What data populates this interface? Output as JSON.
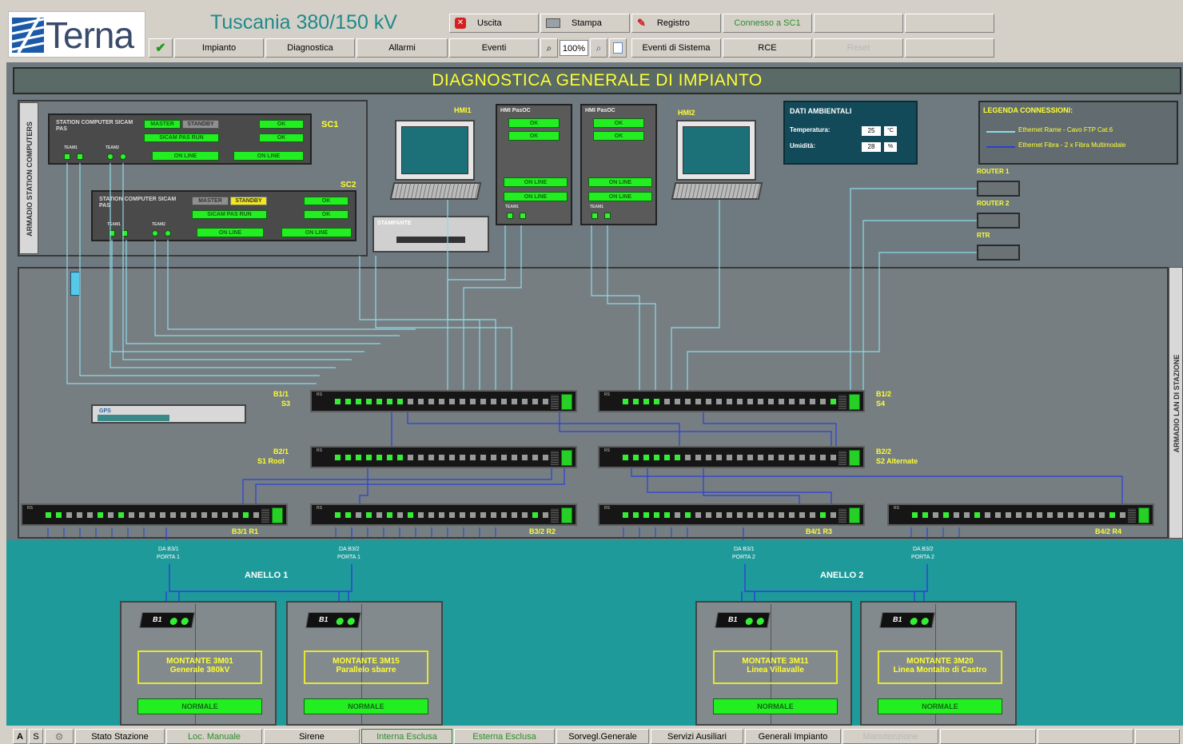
{
  "header": {
    "logo_text": "Terna",
    "station_name": "Tuscania 380/150 kV",
    "buttons": {
      "exit": "Uscita",
      "print": "Stampa",
      "records": "Registro",
      "connection": "Connesso a SC1",
      "plant": "Impianto",
      "diagnostics": "Diagnostica",
      "alarms": "Allarmi",
      "events": "Eventi",
      "zoom_level": "100%",
      "system_events": "Eventi di Sistema",
      "rce": "RCE",
      "disabled_btn": "Reset"
    }
  },
  "main": {
    "title": "DIAGNOSTICA GENERALE DI IMPIANTO",
    "cabinet_label": "ARMADIO STATION COMPUTERS",
    "lan_cabinet_label": "ARMADIO LAN DI STAZIONE",
    "sc1": {
      "id": "SC1",
      "name": "STATION COMPUTER SICAM PAS",
      "master": "MASTER",
      "standby": "STANDBY",
      "status": "SICAM PAS RUN",
      "ok1": "OK",
      "ok2": "OK",
      "online1": "ON LINE",
      "online2": "ON LINE",
      "team1": "TEAM1",
      "team2": "TEAM2"
    },
    "sc2": {
      "id": "SC2",
      "name": "STATION COMPUTER SICAM PAS",
      "master": "MASTER",
      "standby": "STANDBY",
      "status": "SICAM PAS RUN",
      "ok1": "OK",
      "ok2": "OK",
      "online1": "ON LINE",
      "online2": "ON LINE",
      "team1": "TEAM1",
      "team2": "TEAM2"
    },
    "hmi1": "HMI1",
    "hmi2": "HMI2",
    "hmi_pasoc1": {
      "title": "HMI PasOC",
      "ok1": "OK",
      "ok2": "OK",
      "online1": "ON LINE",
      "online2": "ON LINE",
      "team": "TEAM1"
    },
    "hmi_pasoc2": {
      "title": "HMI PasOC",
      "ok1": "OK",
      "ok2": "OK",
      "online1": "ON LINE",
      "online2": "ON LINE",
      "team": "TEAM1"
    },
    "printer": "STAMPANTE",
    "gps": "GPS",
    "env": {
      "title": "DATI AMBIENTALI",
      "temp_label": "Temperatura:",
      "temp_value": "25",
      "temp_unit": "°C",
      "hum_label": "Umidità:",
      "hum_value": "28",
      "hum_unit": "%"
    },
    "legend": {
      "title": "LEGENDA CONNESSIONI:",
      "copper": "Ethernet Rame - Cavo FTP Cat.6",
      "fiber": "Ethernet Fibra - 2 x Fibra Multimodale"
    },
    "routers": {
      "r1": "ROUTER 1",
      "r2": "ROUTER 2",
      "rtr": "RTR"
    },
    "switches": {
      "b11": "B1/1",
      "b11_sub": "S3",
      "b12": "B1/2",
      "b12_sub": "S4",
      "b21": "B2/1",
      "b21_sub": "S1 Root",
      "b22": "B2/2",
      "b22_sub": "S2 Alternate",
      "b31": "B3/1  R1",
      "b32": "B3/2  R2",
      "b41": "B4/1  R3",
      "b42": "B4/2  R4"
    },
    "ring1": "ANELLO 1",
    "ring2": "ANELLO 2",
    "ports": {
      "p1": "DA B3/1",
      "p1b": "PORTA 1",
      "p2": "DA B3/2",
      "p2b": "PORTA 1",
      "p3": "DA B3/1",
      "p3b": "PORTA 2",
      "p4": "DA B3/2",
      "p4b": "PORTA 2"
    },
    "bays": [
      {
        "b1": "B1",
        "title": "MONTANTE 3M01",
        "subtitle": "Generale 380kV",
        "status": "NORMALE"
      },
      {
        "b1": "B1",
        "title": "MONTANTE 3M15",
        "subtitle": "Parallelo sbarre",
        "status": "NORMALE"
      },
      {
        "b1": "B1",
        "title": "MONTANTE 3M11",
        "subtitle": "Linea Villavalle",
        "status": "NORMALE"
      },
      {
        "b1": "B1",
        "title": "MONTANTE 3M20",
        "subtitle": "Linea Montalto di Castro",
        "status": "NORMALE"
      }
    ]
  },
  "footer": {
    "a": "A",
    "s": "S",
    "station_state": "Stato Stazione",
    "local_manual": "Loc. Manuale",
    "siren": "Sirene",
    "internal_excluded": "Interna Esclusa",
    "external_excluded": "Esterna Esclusa",
    "general_watch": "Sorvegl.Generale",
    "aux_services": "Servizi Ausiliari",
    "general_plant": "Generali Impianto",
    "disabled": "Manutenzione"
  },
  "colors": {
    "panel_bg": "#6e7a80",
    "teal_bg": "#1f9a9a",
    "title_bg": "#5a6a66",
    "title_fg": "#ffff33",
    "led_green": "#33ee33",
    "wire_light": "#8ed9e8",
    "wire_dark": "#2a40d8"
  }
}
